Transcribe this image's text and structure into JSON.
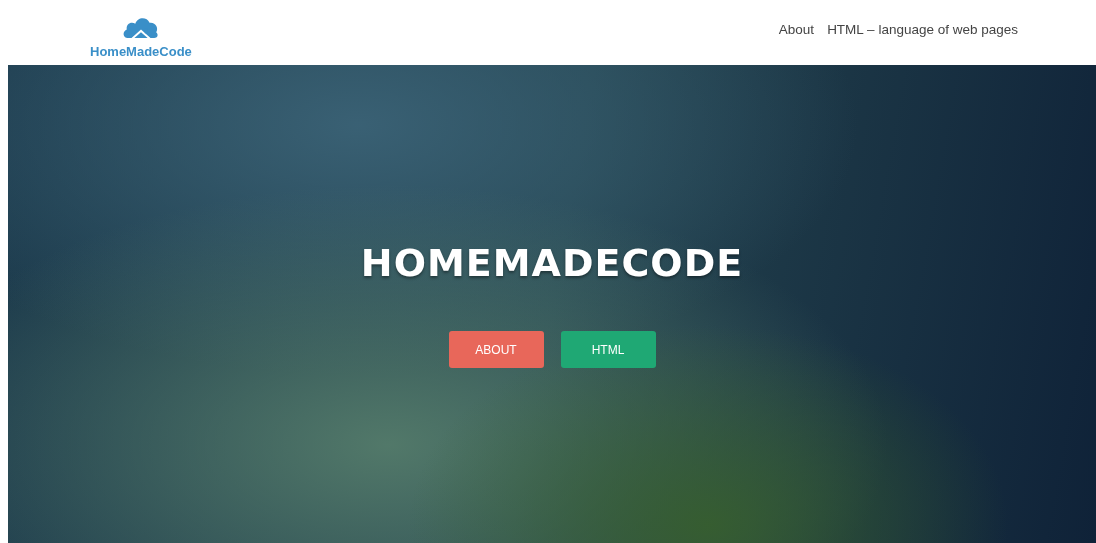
{
  "logo": {
    "text": "HomeMadeCode"
  },
  "nav": [
    {
      "label": "About"
    },
    {
      "label": "HTML – language of web pages"
    }
  ],
  "hero": {
    "title": "HOMEMADECODE",
    "buttons": [
      {
        "label": "ABOUT",
        "color": "#e8675a"
      },
      {
        "label": "HTML",
        "color": "#1fa874"
      }
    ]
  }
}
